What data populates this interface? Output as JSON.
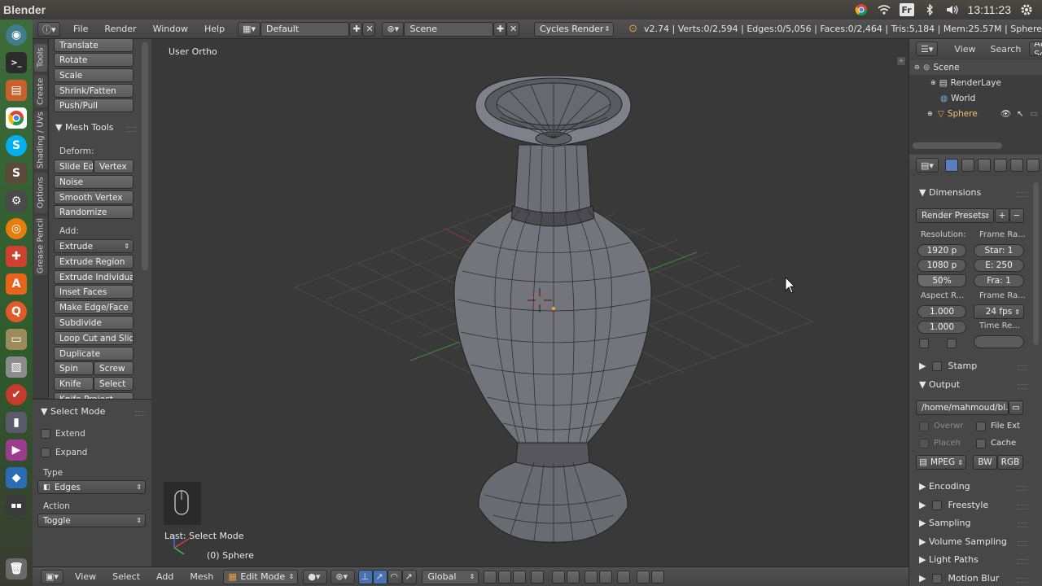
{
  "os": {
    "title": "Blender",
    "clock": "13:11:23",
    "keyboard_layout": "Fr",
    "tray_icons": [
      "chrome-icon",
      "wifi-icon",
      "keyboard-icon",
      "bluetooth-icon",
      "volume-icon",
      "settings-gear-icon"
    ]
  },
  "launcher": {
    "icons": [
      "dash-icon",
      "terminal-icon",
      "files-icon",
      "chrome-icon",
      "skype-icon",
      "sublime-icon",
      "settings-icon",
      "blender-icon",
      "tools-icon",
      "software-center-icon",
      "search-icon",
      "folder-icon",
      "image-viewer-icon",
      "ubuntu-one-icon",
      "monitor-icon",
      "media-icon",
      "virtualbox-icon",
      "workspace-icon",
      "trash-icon"
    ]
  },
  "info_header": {
    "menus": [
      "File",
      "Render",
      "Window",
      "Help"
    ],
    "layout": "Default",
    "scene": "Scene",
    "engine": "Cycles Render",
    "stats": "v2.74 | Verts:0/2,594 | Edges:0/5,056 | Faces:0/2,464 | Tris:5,184 | Mem:25.57M | Sphere"
  },
  "tool_tabs": [
    "Tools",
    "Create",
    "Shading / UVs",
    "Options",
    "Grease Pencil"
  ],
  "toolshelf": {
    "transform_buttons": [
      "Translate",
      "Rotate",
      "Scale",
      "Shrink/Fatten",
      "Push/Pull"
    ],
    "mesh_tools_title": "Mesh Tools",
    "deform_label": "Deform:",
    "slide_edge": "Slide Ed",
    "vertex": "Vertex",
    "noise": "Noise",
    "smooth_vertex": "Smooth Vertex",
    "randomize": "Randomize",
    "add_label": "Add:",
    "extrude": "Extrude",
    "add_buttons": [
      "Extrude Region",
      "Extrude Individual",
      "Inset Faces",
      "Make Edge/Face",
      "Subdivide",
      "Loop Cut and Slide",
      "Duplicate"
    ],
    "spin": "Spin",
    "screw": "Screw",
    "knife": "Knife",
    "select": "Select",
    "knife_project": "Knife Project"
  },
  "operator_panel": {
    "title": "Select Mode",
    "extend": "Extend",
    "expand": "Expand",
    "type_label": "Type",
    "type_value": "Edges",
    "action_label": "Action",
    "action_value": "Toggle"
  },
  "viewport": {
    "view_label": "User Ortho",
    "last_op": "Last: Select Mode",
    "object_label": "(0) Sphere"
  },
  "bottom_header": {
    "menus": [
      "View",
      "Select",
      "Add",
      "Mesh"
    ],
    "mode": "Edit Mode",
    "orientation": "Global"
  },
  "outliner": {
    "view": "View",
    "search": "Search",
    "filter": "All Sc",
    "items": [
      {
        "label": "Scene",
        "level": 0
      },
      {
        "label": "RenderLaye",
        "level": 1
      },
      {
        "label": "World",
        "level": 1
      },
      {
        "label": "Sphere",
        "level": 1
      }
    ]
  },
  "properties": {
    "dimensions": "Dimensions",
    "render_presets": "Render Presets",
    "resolution_label": "Resolution:",
    "frame_range_label": "Frame Ra...",
    "res_x": "1920 p",
    "res_y": "1080 p",
    "res_pct": "50%",
    "start": "Star: 1",
    "end": "E: 250",
    "frame_step": "Fra: 1",
    "aspect_label": "Aspect R...",
    "frame_rate_label": "Frame Ra...",
    "aspect_x": "1.000",
    "aspect_y": "1.000",
    "fps": "24 fps",
    "time_remap_label": "Time Re...",
    "stamp": "Stamp",
    "output": "Output",
    "output_path": "/home/mahmoud/bl...",
    "overwrite": "Overwr",
    "file_ext": "File Ext",
    "placeholders": "Placeh",
    "cache": "Cache",
    "format": "MPEG",
    "bw": "BW",
    "rgb": "RGB",
    "sections": [
      "Encoding",
      "Freestyle",
      "Sampling",
      "Volume Sampling",
      "Light Paths",
      "Motion Blur"
    ]
  }
}
